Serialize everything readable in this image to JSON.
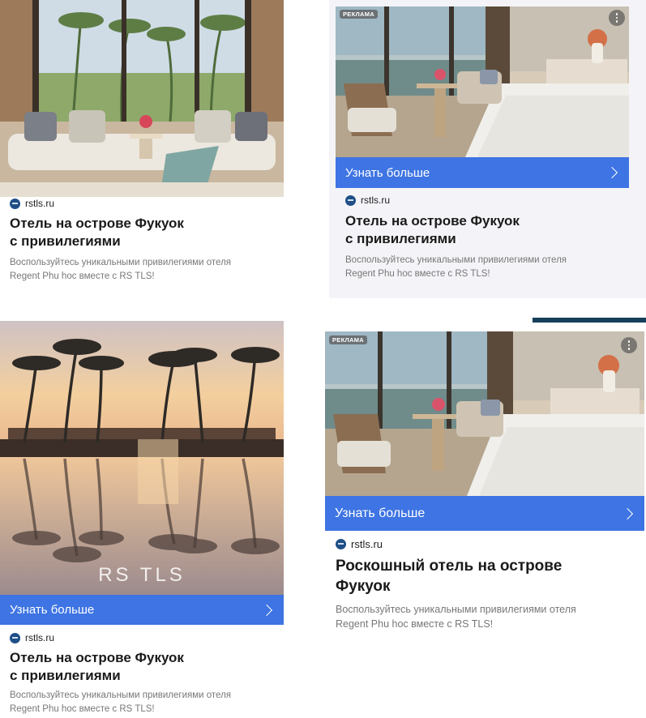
{
  "ads": [
    {
      "domain": "rstls.ru",
      "title_line1": "Отель на острове Фукуок",
      "title_line2": "с привилегиями",
      "desc_line1": "Воспользуйтесь уникальными привилегиями отеля",
      "desc_line2": "Regent Phu hoc вместе с RS TLS!"
    },
    {
      "badge": "РЕКЛАМА",
      "cta": "Узнать больше",
      "domain": "rstls.ru",
      "title_line1": "Отель на острове Фукуок",
      "title_line2": "с привилегиями",
      "desc_line1": "Воспользуйтесь уникальными привилегиями отеля",
      "desc_line2": "Regent Phu hoc вместе с RS TLS!"
    },
    {
      "brand": "RS TLS",
      "cta": "Узнать больше",
      "domain": "rstls.ru",
      "title_line1": "Отель на острове Фукуок",
      "title_line2": "с привилегиями",
      "desc_line1": "Воспользуйтесь уникальными привилегиями отеля",
      "desc_line2": "Regent Phu hoc вместе с RS TLS!"
    },
    {
      "badge": "РЕКЛАМА",
      "cta": "Узнать больше",
      "domain": "rstls.ru",
      "title_line1": "Роскошный отель на острове",
      "title_line2": "Фукуок",
      "desc_line1": "Воспользуйтесь уникальными привилегиями отеля",
      "desc_line2": "Regent Phu hoc вместе с RS TLS!"
    }
  ],
  "colors": {
    "cta": "#3e74e3",
    "accent_bar": "#163f5a",
    "favicon": "#1f4f86"
  }
}
